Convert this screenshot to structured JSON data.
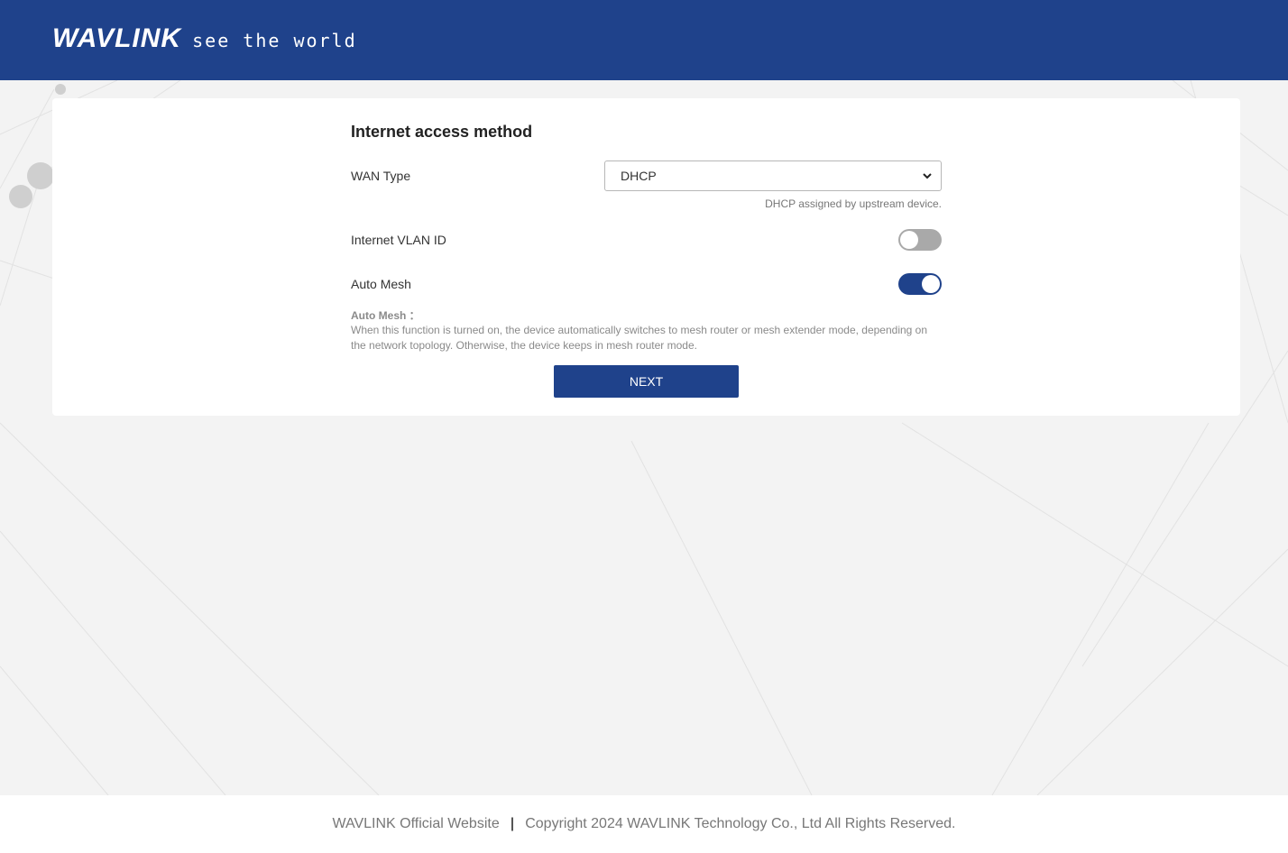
{
  "header": {
    "brand": "WAVLINK",
    "slogan": "see the world"
  },
  "form": {
    "title": "Internet access method",
    "wan_type": {
      "label": "WAN Type",
      "value": "DHCP",
      "hint": "DHCP assigned by upstream device."
    },
    "vlan": {
      "label": "Internet VLAN ID",
      "enabled": false
    },
    "auto_mesh": {
      "label": "Auto Mesh",
      "enabled": true,
      "note_title": "Auto Mesh ：",
      "note_text": "When this function is turned on, the device automatically switches to mesh router or mesh extender mode, depending on the network topology. Otherwise, the device keeps in mesh router mode."
    },
    "next_label": "NEXT"
  },
  "footer": {
    "website_link": "WAVLINK Official Website",
    "separator": "|",
    "copyright": "Copyright 2024 WAVLINK Technology Co., Ltd All Rights Reserved."
  },
  "colors": {
    "primary": "#1f428b",
    "toggle_off": "#a9a9a9"
  }
}
